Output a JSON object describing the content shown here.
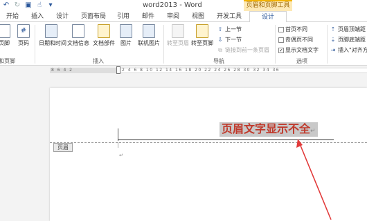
{
  "titlebar": {
    "title": "word2013 - Word",
    "contextual_tab_group": "页眉和页脚工具",
    "qat_icons": [
      "undo-icon",
      "redo-icon",
      "save-icon",
      "touch-mode-icon",
      "customize-qat-icon"
    ]
  },
  "tabs": [
    {
      "label": "开始"
    },
    {
      "label": "插入"
    },
    {
      "label": "设计"
    },
    {
      "label": "页面布局"
    },
    {
      "label": "引用"
    },
    {
      "label": "邮件"
    },
    {
      "label": "审阅"
    },
    {
      "label": "视图"
    },
    {
      "label": "开发工具"
    },
    {
      "label": "设计",
      "active": true
    }
  ],
  "ribbon": {
    "header_footer_group": {
      "buttons": [
        {
          "label": "页脚"
        },
        {
          "label": "页码"
        }
      ],
      "label": "和页脚"
    },
    "insert_group": {
      "buttons": [
        {
          "label": "日期和时间"
        },
        {
          "label": "文档信息"
        },
        {
          "label": "文档部件"
        },
        {
          "label": "图片"
        },
        {
          "label": "联机图片"
        }
      ],
      "label": "插入"
    },
    "nav_group": {
      "buttons": [
        {
          "label": "转至页眉",
          "disabled": true
        },
        {
          "label": "转至页脚"
        }
      ],
      "small": [
        {
          "label": "上一节"
        },
        {
          "label": "下一节"
        },
        {
          "label": "链接到前一条页眉",
          "disabled": true
        }
      ],
      "label": "导航"
    },
    "options_group": {
      "checkboxes": [
        {
          "label": "首页不同",
          "checked": false
        },
        {
          "label": "奇偶页不同",
          "checked": false
        },
        {
          "label": "显示文档文字",
          "checked": true
        }
      ],
      "label": "选项"
    },
    "position_group": {
      "items": [
        {
          "label": "页眉顶端距"
        },
        {
          "label": "页脚底端距"
        },
        {
          "label": "插入\"对齐方"
        }
      ]
    }
  },
  "ruler": {
    "left_numbers": "8 6 4 2",
    "right_numbers": "2 4 6 8 10 12 14 16 18 20 22 24 26 28 30 32 34 36"
  },
  "document": {
    "header_tag": "页眉",
    "header_text": "页眉文字显示不全",
    "para_mark": "↵",
    "header_text_color": "#c0392b",
    "arrow_color": "#e23b3b"
  }
}
